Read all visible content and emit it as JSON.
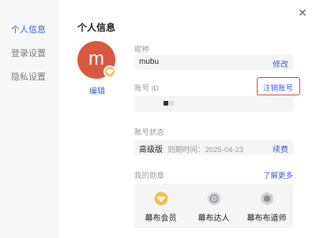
{
  "sidebar": {
    "items": [
      {
        "label": "个人信息",
        "active": true
      },
      {
        "label": "登录设置",
        "active": false
      },
      {
        "label": "隐私设置",
        "active": false
      }
    ]
  },
  "title": "个人信息",
  "close_icon": "close-icon",
  "avatar": {
    "letter": "m",
    "color": "#d9583f",
    "badge_icon": "diamond-icon",
    "edit_label": "编辑"
  },
  "nickname": {
    "label": "昵称",
    "value": "mubu",
    "action": "修改"
  },
  "account_id": {
    "label": "账号 ID",
    "action": "注销账号"
  },
  "status": {
    "label": "账号状态",
    "plan": "高级版",
    "expire": "到期时间：2025-04-23",
    "action": "续费"
  },
  "badges": {
    "label": "我的勋章",
    "link": "了解更多",
    "items": [
      {
        "name": "幕布会员",
        "icon": "diamond-badge-icon"
      },
      {
        "name": "幕布达人",
        "icon": "gear-badge-icon"
      },
      {
        "name": "幕布布道师",
        "icon": "hexagon-badge-icon"
      }
    ]
  },
  "colors": {
    "accent": "#3f5bd8",
    "highlight": "#e53935"
  }
}
